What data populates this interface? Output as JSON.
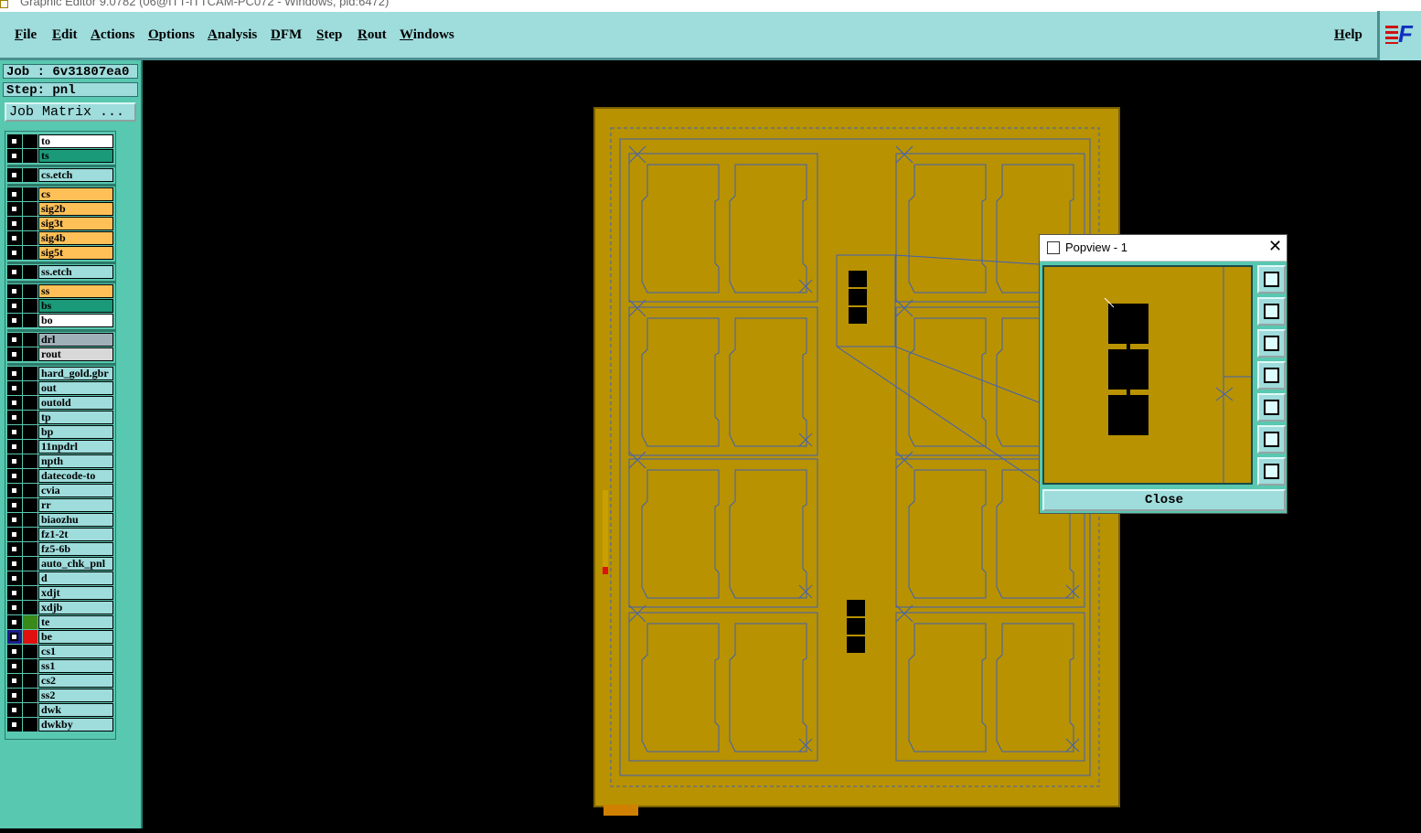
{
  "window": {
    "title": "Graphic Editor 9.0782 (06@ITT-ITTCAM-PC072 - Windows, pid:6472)"
  },
  "menu": {
    "items": [
      "File",
      "Edit",
      "Actions",
      "Options",
      "Analysis",
      "DFM",
      "Step",
      "Rout",
      "Windows"
    ],
    "help": "Help",
    "logo": "F"
  },
  "job": {
    "job_label": "Job : 6v31807ea0",
    "step_label": "Step: pnl",
    "matrix_button": "Job Matrix ..."
  },
  "layers": [
    {
      "name": "to",
      "color": "#ffffff"
    },
    {
      "name": "ts",
      "color": "#1a9a78"
    },
    {
      "name": "cs.etch",
      "color": "#9fdcdc"
    },
    {
      "name": "cs",
      "color": "#ffc058"
    },
    {
      "name": "sig2b",
      "color": "#ffc058"
    },
    {
      "name": "sig3t",
      "color": "#ffc058"
    },
    {
      "name": "sig4b",
      "color": "#ffc058"
    },
    {
      "name": "sig5t",
      "color": "#ffc058"
    },
    {
      "name": "ss.etch",
      "color": "#9fdcdc"
    },
    {
      "name": "ss",
      "color": "#ffc058"
    },
    {
      "name": "bs",
      "color": "#1a9a78"
    },
    {
      "name": "bo",
      "color": "#ffffff"
    },
    {
      "name": "drl",
      "color": "#a0b0b8"
    },
    {
      "name": "rout",
      "color": "#d8d8d8"
    },
    {
      "name": "hard_gold.gbr",
      "color": "#9fdcdc"
    },
    {
      "name": "out",
      "color": "#9fdcdc"
    },
    {
      "name": "outold",
      "color": "#9fdcdc"
    },
    {
      "name": "tp",
      "color": "#9fdcdc"
    },
    {
      "name": "bp",
      "color": "#9fdcdc"
    },
    {
      "name": "11npdrl",
      "color": "#9fdcdc"
    },
    {
      "name": "npth",
      "color": "#9fdcdc"
    },
    {
      "name": "datecode-to",
      "color": "#9fdcdc"
    },
    {
      "name": "cvia",
      "color": "#9fdcdc"
    },
    {
      "name": "rr",
      "color": "#9fdcdc"
    },
    {
      "name": "biaozhu",
      "color": "#9fdcdc"
    },
    {
      "name": "fz1-2t",
      "color": "#9fdcdc"
    },
    {
      "name": "fz5-6b",
      "color": "#9fdcdc"
    },
    {
      "name": "auto_chk_pnl",
      "color": "#9fdcdc"
    },
    {
      "name": "d",
      "color": "#9fdcdc"
    },
    {
      "name": "xdjt",
      "color": "#9fdcdc"
    },
    {
      "name": "xdjb",
      "color": "#9fdcdc"
    },
    {
      "name": "te",
      "color": "#9fdcdc",
      "swatch": "#3a8a1a"
    },
    {
      "name": "be",
      "color": "#9fdcdc",
      "swatch": "#e01010",
      "active": true
    },
    {
      "name": "cs1",
      "color": "#9fdcdc"
    },
    {
      "name": "ss1",
      "color": "#9fdcdc"
    },
    {
      "name": "cs2",
      "color": "#9fdcdc"
    },
    {
      "name": "ss2",
      "color": "#9fdcdc"
    },
    {
      "name": "dwk",
      "color": "#9fdcdc"
    },
    {
      "name": "dwkby",
      "color": "#9fdcdc"
    }
  ],
  "popview": {
    "title": "Popview - 1",
    "close_label": "Close"
  },
  "colors": {
    "panel_fill": "#b89200",
    "outline": "#4060b8",
    "accent": "#9fdcdc"
  }
}
